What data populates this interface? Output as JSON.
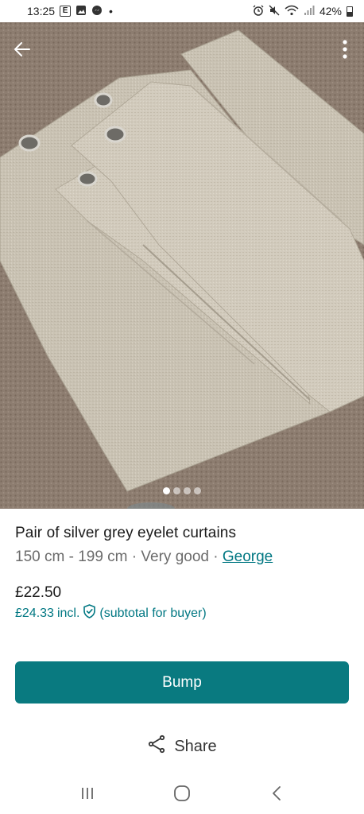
{
  "status_bar": {
    "time": "13:25",
    "notif_icons": [
      "E",
      "image-icon",
      "messenger-icon"
    ],
    "dot": "•",
    "battery_level": "42%"
  },
  "hero": {
    "image": "folded grey eyelet curtains on carpet",
    "carousel": {
      "count": 4,
      "active_index": 0
    }
  },
  "item": {
    "title": "Pair of silver grey eyelet curtains",
    "size": "150 cm - 199 cm",
    "separator": " · ",
    "condition": "Very good",
    "brand": "George",
    "price": "£22.50",
    "buyer_price": "£24.33",
    "buyer_price_incl": "incl.",
    "buyer_price_note": "(subtotal for buyer)"
  },
  "actions": {
    "bump_label": "Bump",
    "share_label": "Share"
  },
  "colors": {
    "accent": "#007782",
    "button": "#097a80"
  }
}
